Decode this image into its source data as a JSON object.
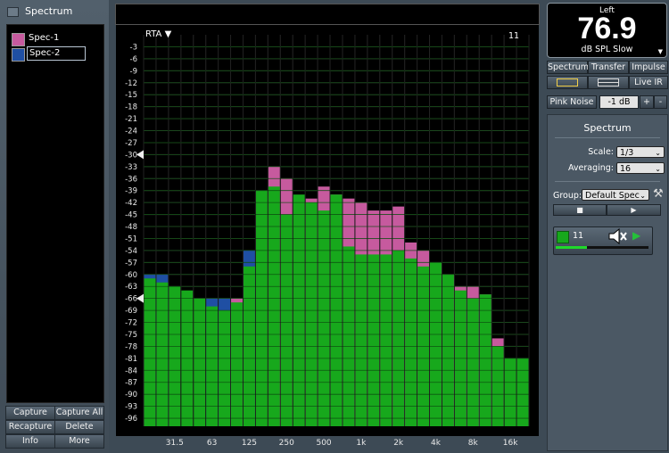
{
  "left_panel": {
    "title": "Spectrum",
    "specs": [
      {
        "label": "Spec-1",
        "color": "#c65a9e"
      },
      {
        "label": "Spec-2",
        "color": "#1f4fa3"
      }
    ],
    "buttons": [
      "Capture",
      "Capture All",
      "Recapture",
      "Delete",
      "Info",
      "More"
    ]
  },
  "plot": {
    "mode_label": "RTA",
    "mode_arrow": "▼",
    "count": "11",
    "y_ticks": [
      "-3",
      "-6",
      "-9",
      "-12",
      "-15",
      "-18",
      "-21",
      "-24",
      "-27",
      "-30",
      "-33",
      "-36",
      "-39",
      "-42",
      "-45",
      "-48",
      "-51",
      "-54",
      "-57",
      "-60",
      "-63",
      "-66",
      "-69",
      "-72",
      "-75",
      "-78",
      "-81",
      "-84",
      "-87",
      "-90",
      "-93",
      "-96"
    ],
    "x_ticks": [
      "31.5",
      "63",
      "125",
      "250",
      "500",
      "1k",
      "2k",
      "4k",
      "8k",
      "16k"
    ],
    "colors": {
      "green": "#17a81c",
      "magenta": "#c65a9e",
      "blue": "#1f4fa3",
      "grid": "#3a3a3a"
    }
  },
  "right_panel": {
    "channel": "Left",
    "spl_value": "76.9",
    "spl_unit": "dB SPL Slow",
    "spl_drop": "▼",
    "mode_buttons": [
      "Spectrum",
      "Transfer",
      "Impulse"
    ],
    "live_ir": "Live IR",
    "pink_noise": "Pink Noise",
    "pink_level": "-1 dB",
    "plus": "+",
    "minus": "-",
    "settings_title": "Spectrum",
    "scale_label": "Scale:",
    "scale_value": "1/3",
    "averaging_label": "Averaging:",
    "averaging_value": "16",
    "group_label": "Group:",
    "group_value": "Default Spec",
    "tools_icon": "⚒",
    "stop_icon": "■",
    "play_icon": "▶",
    "group_count": "11"
  },
  "chart_data": {
    "type": "bar",
    "title": "",
    "xlabel": "",
    "ylabel": "",
    "ylim": [
      -98,
      0
    ],
    "x_scale": "log (1/3 octave)",
    "categories": [
      "20",
      "25",
      "31.5",
      "40",
      "50",
      "63",
      "80",
      "100",
      "125",
      "160",
      "200",
      "250",
      "315",
      "400",
      "500",
      "630",
      "800",
      "1k",
      "1.25k",
      "1.6k",
      "2k",
      "2.5k",
      "3.15k",
      "4k",
      "5k",
      "6.3k",
      "8k",
      "10k",
      "12.5k",
      "16k",
      "20k"
    ],
    "series": [
      {
        "name": "",
        "values": [
          -61,
          -62,
          -63,
          -64,
          -66,
          -68,
          -69,
          -67,
          -58,
          -39,
          -38,
          -45,
          -40,
          -42,
          -44,
          -40,
          -53,
          -55,
          -55,
          -55,
          -54,
          -56,
          -58,
          -57,
          -60,
          -64,
          -66,
          -65,
          -78,
          -81,
          -81
        ]
      },
      {
        "name": "Spec-1",
        "values": [
          null,
          null,
          null,
          null,
          null,
          null,
          null,
          -66,
          null,
          null,
          -33,
          -36,
          null,
          -41,
          -38,
          -40,
          -41,
          -42,
          -44,
          -44,
          -43,
          -52,
          -54,
          -57,
          -60,
          -63,
          -63,
          -65,
          -76,
          null,
          null
        ]
      },
      {
        "name": "Spec-2",
        "values": [
          -60,
          -60,
          null,
          null,
          null,
          -66,
          -66,
          null,
          -54,
          null,
          null,
          null,
          null,
          null,
          null,
          null,
          null,
          null,
          null,
          null,
          null,
          null,
          null,
          null,
          null,
          null,
          -66,
          -68,
          null,
          null,
          null
        ]
      }
    ]
  }
}
